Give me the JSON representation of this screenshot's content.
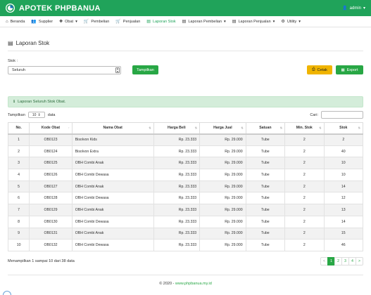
{
  "app": {
    "brand": "APOTEK PHPBANUA",
    "user": "admin"
  },
  "nav": [
    {
      "label": "Beranda",
      "icon": "home-icon",
      "glyph": "⌂",
      "dropdown": false,
      "active": false
    },
    {
      "label": "Supplier",
      "icon": "users-icon",
      "glyph": "👥",
      "dropdown": false,
      "active": false
    },
    {
      "label": "Obat",
      "icon": "medkit-icon",
      "glyph": "✚",
      "dropdown": true,
      "active": false
    },
    {
      "label": "Pembelian",
      "icon": "cart-icon",
      "glyph": "🛒",
      "dropdown": false,
      "active": false
    },
    {
      "label": "Penjualan",
      "icon": "cart-icon",
      "glyph": "🛒",
      "dropdown": false,
      "active": false
    },
    {
      "label": "Laporan Stok",
      "icon": "file-icon",
      "glyph": "▤",
      "dropdown": false,
      "active": true
    },
    {
      "label": "Laporan Pembelian",
      "icon": "file-icon",
      "glyph": "▤",
      "dropdown": true,
      "active": false
    },
    {
      "label": "Laporan Penjualan",
      "icon": "file-icon",
      "glyph": "▤",
      "dropdown": true,
      "active": false
    },
    {
      "label": "Utility",
      "icon": "user-cog-icon",
      "glyph": "⚙",
      "dropdown": true,
      "active": false
    }
  ],
  "page": {
    "title": "Laporan Stok"
  },
  "filter": {
    "label": "Stok :",
    "selected": "Seluruh",
    "tampilkan": "Tampilkan",
    "cetak": "Cetak",
    "export": "Export"
  },
  "alert": {
    "text": "Laporan Seluruh Stok Obat."
  },
  "datatable": {
    "show_prefix": "Tampilkan",
    "length": "10",
    "show_suffix": "data",
    "search_label": "Cari:",
    "info": "Menampilkan 1 sampai 10 dari 38 data",
    "pages": [
      "<",
      "1",
      "2",
      "3",
      "4",
      ">"
    ],
    "active_page": "1"
  },
  "columns": [
    "No.",
    "Kode Obat",
    "Nama Obat",
    "Harga Beli",
    "Harga Jual",
    "Satuan",
    "Min. Stok",
    "Stok"
  ],
  "rows": [
    [
      "1",
      "OB0123",
      "Bisolvon Kids",
      "Rp. 23.333",
      "Rp. 29.000",
      "Tube",
      "2",
      "2"
    ],
    [
      "2",
      "OB0124",
      "Bisolvon Extra",
      "Rp. 23.333",
      "Rp. 29.000",
      "Tube",
      "2",
      "40"
    ],
    [
      "3",
      "OB0125",
      "OBH Combi Anak",
      "Rp. 23.333",
      "Rp. 29.000",
      "Tube",
      "2",
      "10"
    ],
    [
      "4",
      "OB0126",
      "OBH Combi Dewasa",
      "Rp. 23.333",
      "Rp. 29.000",
      "Tube",
      "2",
      "10"
    ],
    [
      "5",
      "OB0127",
      "OBH Combi Anak",
      "Rp. 23.333",
      "Rp. 29.000",
      "Tube",
      "2",
      "14"
    ],
    [
      "6",
      "OB0128",
      "OBH Combi Dewasa",
      "Rp. 23.333",
      "Rp. 29.000",
      "Tube",
      "2",
      "12"
    ],
    [
      "7",
      "OB0129",
      "OBH Combi Anak",
      "Rp. 23.333",
      "Rp. 29.000",
      "Tube",
      "2",
      "13"
    ],
    [
      "8",
      "OB0130",
      "OBH Combi Dewasa",
      "Rp. 23.333",
      "Rp. 29.000",
      "Tube",
      "2",
      "14"
    ],
    [
      "9",
      "OB0131",
      "OBH Combi Anak",
      "Rp. 23.333",
      "Rp. 29.000",
      "Tube",
      "2",
      "15"
    ],
    [
      "10",
      "OB0132",
      "OBH Combi Dewasa",
      "Rp. 23.333",
      "Rp. 29.000",
      "Tube",
      "2",
      "46"
    ]
  ],
  "footer": {
    "copyright": "© 2020 - ",
    "link": "www.phpbanua.my.id"
  },
  "colors": {
    "primary": "#20a35a",
    "button_green": "#28a745",
    "button_yellow": "#f0b400",
    "alert_bg": "#d4edda"
  }
}
